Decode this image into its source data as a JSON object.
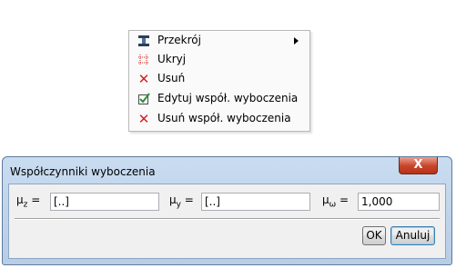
{
  "context_menu": {
    "items": [
      {
        "label": "Przekrój",
        "icon": "beam-section-icon",
        "has_submenu": true
      },
      {
        "label": "Ukryj",
        "icon": "hide-dotted-grid-icon"
      },
      {
        "label": "Usuń",
        "icon": "delete-x-icon"
      },
      {
        "label": "Edytuj współ. wyboczenia",
        "icon": "edit-checkbox-icon"
      },
      {
        "label": "Usuń współ. wyboczenia",
        "icon": "delete-x-icon"
      }
    ]
  },
  "dialog": {
    "title": "Współczynniki wyboczenia",
    "close_symbol": "X",
    "fields": [
      {
        "symbol": "μ",
        "subscript": "z",
        "equals": "=",
        "value": "[..]"
      },
      {
        "symbol": "μ",
        "subscript": "y",
        "equals": "=",
        "value": "[..]"
      },
      {
        "symbol": "μ",
        "subscript": "ω",
        "equals": "=",
        "value": "1,000"
      }
    ],
    "ok_label": "OK",
    "cancel_label": "Anuluj"
  },
  "colors": {
    "delete_icon": "#d42020",
    "title_bar": "#b7cde6",
    "close_button": "#c7432a"
  }
}
